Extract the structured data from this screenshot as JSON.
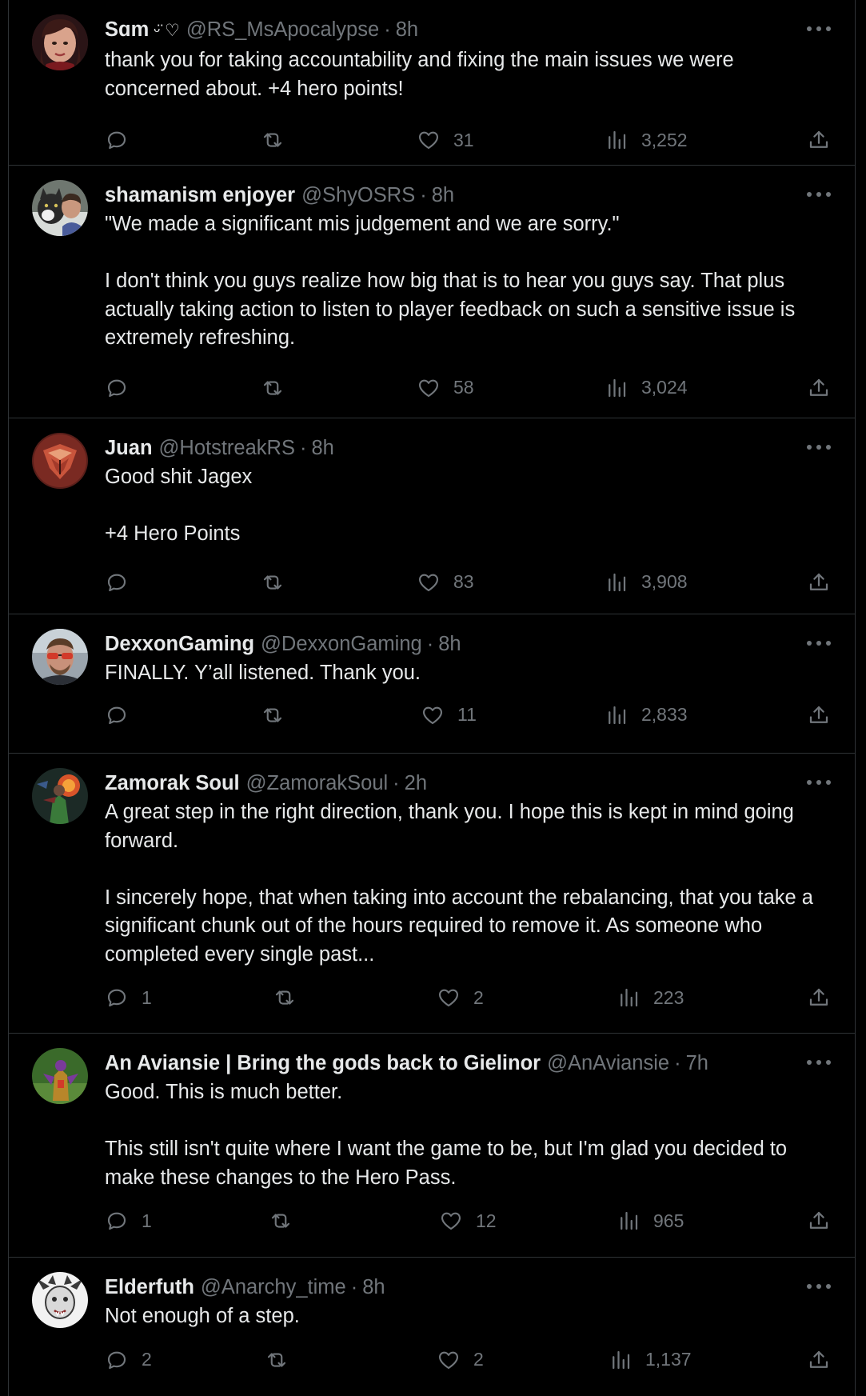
{
  "tweets": [
    {
      "name": "Sɑm",
      "name_suffix": "ᵕ̈ ♡",
      "handle": "@RS_MsApocalypse",
      "time": "8h",
      "text": "thank you for taking accountability and fixing the main issues we were concerned about. +4 hero points!",
      "replies": "",
      "likes": "31",
      "views": "3,252",
      "avatar": "woman-portrait"
    },
    {
      "name": "shamanism enjoyer",
      "handle": "@ShyOSRS",
      "time": "8h",
      "text": "\"We made a significant mis judgement and we are sorry.\"\n\nI don't think you guys realize how big that is to hear you guys say. That plus actually taking action to listen to player feedback on such a sensitive issue is extremely refreshing.",
      "replies": "",
      "likes": "58",
      "views": "3,024",
      "avatar": "man-with-cat"
    },
    {
      "name": "Juan",
      "handle": "@HotstreakRS",
      "time": "8h",
      "text": "Good shit Jagex\n\n+4 Hero Points",
      "replies": "",
      "likes": "83",
      "views": "3,908",
      "avatar": "red-emblem"
    },
    {
      "name": "DexxonGaming",
      "handle": "@DexxonGaming",
      "time": "8h",
      "text": "FINALLY. Y’all listened. Thank you.",
      "replies": "",
      "likes": "11",
      "views": "2,833",
      "avatar": "man-sunglasses"
    },
    {
      "name": "Zamorak Soul",
      "handle": "@ZamorakSoul",
      "time": "2h",
      "text": "A great step in the right direction, thank you. I hope this is kept in mind going forward.\n\nI sincerely hope, that when taking into account the rebalancing, that you take a significant chunk out of the hours required to remove it. As someone who completed every single past...",
      "replies": "1",
      "likes": "2",
      "views": "223",
      "avatar": "game-character-fire"
    },
    {
      "name": "An Aviansie | Bring the gods back to Gielinor",
      "handle": "@AnAviansie",
      "time": "7h",
      "text": "Good. This is much better.\n\nThis still isn't quite where I want the game to be, but I'm glad you decided to make these changes to the Hero Pass.",
      "replies": "1",
      "likes": "12",
      "views": "965",
      "avatar": "game-character-bird"
    },
    {
      "name": "Elderfuth",
      "handle": "@Anarchy_time",
      "time": "8h",
      "text": "Not enough of a step.",
      "replies": "2",
      "likes": "2",
      "views": "1,137",
      "avatar": "drawn-creature"
    }
  ],
  "separator": "·",
  "icons": {
    "reply": "reply-icon",
    "retweet": "retweet-icon",
    "like": "heart-icon",
    "views": "views-icon",
    "share": "share-icon",
    "more": "more-icon"
  },
  "colors": {
    "background": "#000000",
    "text": "#e7e9ea",
    "muted": "#71767b",
    "divider": "#2f3336"
  }
}
